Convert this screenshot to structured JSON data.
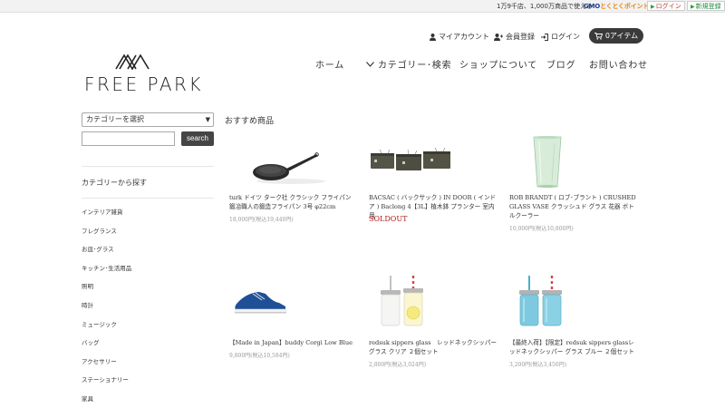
{
  "gmo_bar": {
    "text": "1万9千店、1,000万商品で使える",
    "logo_g": "GMO",
    "logo_k": "とくとくポイント",
    "login": "ログイン",
    "register": "新規登録"
  },
  "account": {
    "my_account": "マイアカウント",
    "register": "会員登録",
    "login": "ログイン",
    "cart": "0アイテム"
  },
  "logo": {
    "text": "FREE PARK"
  },
  "nav": {
    "home": "ホーム",
    "category": "カテゴリー･検索",
    "about": "ショップについて",
    "blog": "ブログ",
    "contact": "お問い合わせ"
  },
  "sidebar": {
    "select_value": "カテゴリーを選択",
    "search_value": "",
    "search_button": "search",
    "heading": "カテゴリーから探す",
    "categories": [
      "インテリア雑貨",
      "フレグランス",
      "お皿･グラス",
      "キッチン･生活用品",
      "照明",
      "時計",
      "ミュージック",
      "バッグ",
      "アクセサリー",
      "ステーショナリー",
      "家具"
    ]
  },
  "main": {
    "section_title": "おすすめ商品",
    "products": [
      {
        "name": "turk ドイツ ターク社 クラシック フライパン 鍛冶職人の鍛造フライパン 3号 φ22cm",
        "price": "18,000円(税込19,440円)",
        "soldout": ""
      },
      {
        "name": "BACSAC ( バックサック ) IN DOOR ( インドア ) Baclong 4【3L】植木鉢 プランター 室内用",
        "price": "",
        "soldout": "SOLDOUT"
      },
      {
        "name": "ROB BRANDT ( ロブ･ブラント ) CRUSHED GLASS VASE クラッシュド グラス 花器 ボトルクーラー",
        "price": "10,000円(税込10,800円)",
        "soldout": ""
      },
      {
        "name": "【Made in Japan】buddy Corgi Low Blue",
        "price": "9,800円(税込10,584円)",
        "soldout": ""
      },
      {
        "name": "redsuk sippers glass　レッドネックシッパーグラス クリア ２個セット",
        "price": "2,800円(税込3,024円)",
        "soldout": ""
      },
      {
        "name": "【最終入荷】【限定】redsuk sippers glassレッドネックシッパー グラス ブルー ２個セット",
        "price": "3,200円(税込3,456円)",
        "soldout": ""
      }
    ]
  },
  "colors": {
    "accent_dark": "#3a3a3a",
    "soldout": "#b01a1a",
    "price_gray": "#999999"
  }
}
